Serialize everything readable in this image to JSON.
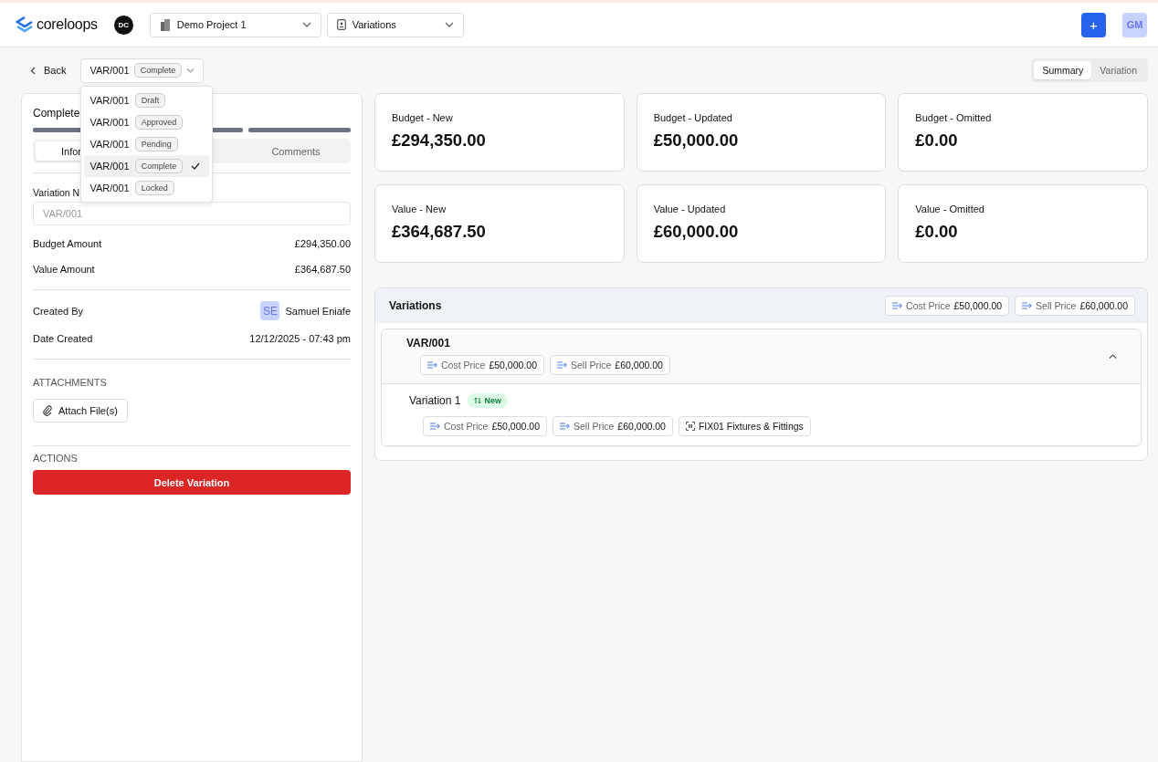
{
  "header": {
    "logo": "coreloops",
    "org_badge": "DC",
    "project_select": "Demo Project 1",
    "module_select": "Variations",
    "add_button": "+",
    "user_avatar": "GM"
  },
  "toolbar": {
    "back": "Back",
    "variation_select": {
      "code": "VAR/001",
      "status": "Complete"
    },
    "dropdown": [
      {
        "code": "VAR/001",
        "status": "Draft",
        "selected": false
      },
      {
        "code": "VAR/001",
        "status": "Approved",
        "selected": false
      },
      {
        "code": "VAR/001",
        "status": "Pending",
        "selected": false
      },
      {
        "code": "VAR/001",
        "status": "Complete",
        "selected": true
      },
      {
        "code": "VAR/001",
        "status": "Locked",
        "selected": false
      }
    ],
    "view_tabs": [
      {
        "label": "Summary",
        "selected": true
      },
      {
        "label": "Variation",
        "selected": false
      }
    ]
  },
  "detail": {
    "status_title": "Complete",
    "tabs": [
      {
        "label": "Infor",
        "selected": true
      },
      {
        "label": "Comments",
        "selected": false
      }
    ],
    "variation_number": {
      "label": "Variation N",
      "placeholder": "VAR/001"
    },
    "amounts": [
      {
        "label": "Budget Amount",
        "value": "£294,350.00"
      },
      {
        "label": "Value Amount",
        "value": "£364,687.50"
      }
    ],
    "created_by": {
      "label": "Created By",
      "initials": "SE",
      "name": "Samuel Eniafe"
    },
    "date_created": {
      "label": "Date Created",
      "value": "12/12/2025 - 07:43 pm"
    },
    "attachments_heading": "ATTACHMENTS",
    "attach_button": "Attach File(s)",
    "actions_heading": "ACTIONS",
    "delete_button": "Delete Variation"
  },
  "stats": [
    {
      "label": "Budget - New",
      "value": "£294,350.00"
    },
    {
      "label": "Budget - Updated",
      "value": "£50,000.00"
    },
    {
      "label": "Budget - Omitted",
      "value": "£0.00"
    },
    {
      "label": "Value - New",
      "value": "£364,687.50"
    },
    {
      "label": "Value - Updated",
      "value": "£60,000.00"
    },
    {
      "label": "Value - Omitted",
      "value": "£0.00"
    }
  ],
  "variations": {
    "title": "Variations",
    "totals": [
      {
        "label": "Cost Price",
        "value": "£50,000.00"
      },
      {
        "label": "Sell Price",
        "value": "£60,000.00"
      }
    ],
    "groups": [
      {
        "code": "VAR/001",
        "expanded": true,
        "chips": [
          {
            "label": "Cost Price",
            "value": "£50,000.00"
          },
          {
            "label": "Sell Price",
            "value": "£60,000.00"
          }
        ],
        "items": [
          {
            "name": "Variation 1",
            "badge": "New",
            "chips": [
              {
                "kind": "price",
                "label": "Cost Price",
                "value": "£50,000.00"
              },
              {
                "kind": "price",
                "label": "Sell Price",
                "value": "£60,000.00"
              },
              {
                "kind": "code",
                "text": "FIX01 Fixtures & Fittings"
              }
            ]
          }
        ]
      }
    ]
  }
}
